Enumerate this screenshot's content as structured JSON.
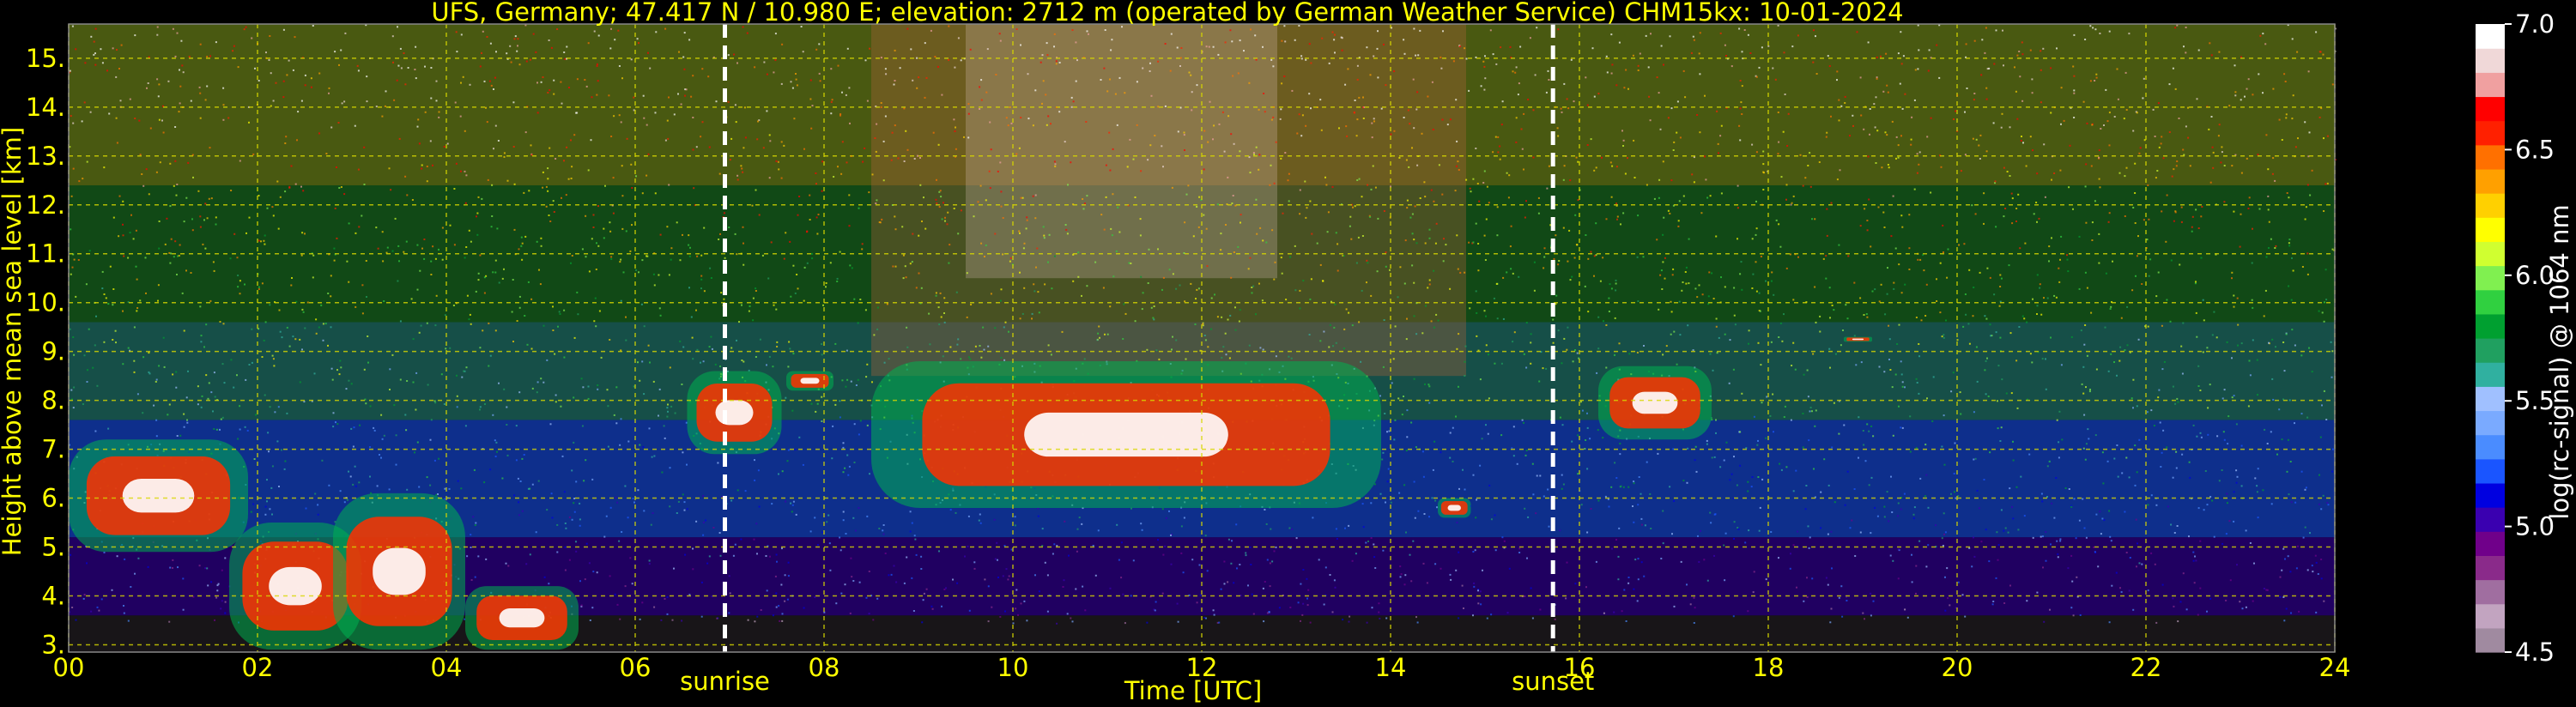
{
  "chart_data": {
    "type": "heatmap",
    "title": "UFS, Germany; 47.417 N / 10.980 E; elevation: 2712 m  (operated by German Weather Service)    CHM15kx: 10-01-2024",
    "xlabel": "Time [UTC]",
    "ylabel": "Height above mean sea level [km]",
    "xlim": [
      0,
      24
    ],
    "ylim": [
      2.85,
      15.7
    ],
    "x_ticks": [
      "00",
      "02",
      "04",
      "06",
      "08",
      "10",
      "12",
      "14",
      "16",
      "18",
      "20",
      "22",
      "24"
    ],
    "y_ticks": [
      "3.",
      "4.",
      "5.",
      "6.",
      "7.",
      "8.",
      "9.",
      "10.",
      "11.",
      "12.",
      "13.",
      "14.",
      "15."
    ],
    "grid": true,
    "colorbar": {
      "label": "log(rc-signal) @ 1064 nm",
      "range": [
        4.5,
        7.0
      ],
      "ticks": [
        "4.5",
        "5.0",
        "5.5",
        "6.0",
        "6.5",
        "7.0"
      ]
    },
    "annotations": [
      {
        "label": "sunrise",
        "time": 6.95
      },
      {
        "label": "sunset",
        "time": 15.72
      }
    ],
    "cloud_layers": [
      {
        "t0": 0.0,
        "t1": 1.9,
        "base_km": 4.9,
        "top_km": 7.2
      },
      {
        "t0": 1.7,
        "t1": 3.1,
        "base_km": 2.9,
        "top_km": 5.5
      },
      {
        "t0": 2.8,
        "t1": 4.2,
        "base_km": 2.9,
        "top_km": 6.1
      },
      {
        "t0": 4.2,
        "t1": 5.4,
        "base_km": 2.9,
        "top_km": 4.2
      },
      {
        "t0": 6.55,
        "t1": 7.55,
        "base_km": 6.9,
        "top_km": 8.6
      },
      {
        "t0": 7.6,
        "t1": 8.1,
        "base_km": 8.2,
        "top_km": 8.6
      },
      {
        "t0": 8.5,
        "t1": 13.9,
        "base_km": 5.8,
        "top_km": 8.8
      },
      {
        "t0": 14.5,
        "t1": 14.85,
        "base_km": 5.6,
        "top_km": 6.0
      },
      {
        "t0": 16.2,
        "t1": 17.4,
        "base_km": 7.2,
        "top_km": 8.7
      },
      {
        "t0": 18.8,
        "t1": 19.1,
        "base_km": 9.2,
        "top_km": 9.3
      }
    ]
  },
  "colors": {
    "text": "#ffff00",
    "colorbar_text": "#ffffff",
    "grid": "#d8d800",
    "colormap": [
      "#a08aa0",
      "#c2a4c0",
      "#a06ea0",
      "#8a2a8a",
      "#70008a",
      "#3a00b0",
      "#0000e0",
      "#1a55ff",
      "#4a8cff",
      "#7aaaff",
      "#a0c0ff",
      "#30b0a0",
      "#20a060",
      "#00a030",
      "#30d040",
      "#80f050",
      "#d0ff30",
      "#ffff00",
      "#ffd000",
      "#ffa000",
      "#ff7000",
      "#ff2000",
      "#ff0000",
      "#f0a0a0",
      "#f0d8d8",
      "#ffffff"
    ]
  }
}
